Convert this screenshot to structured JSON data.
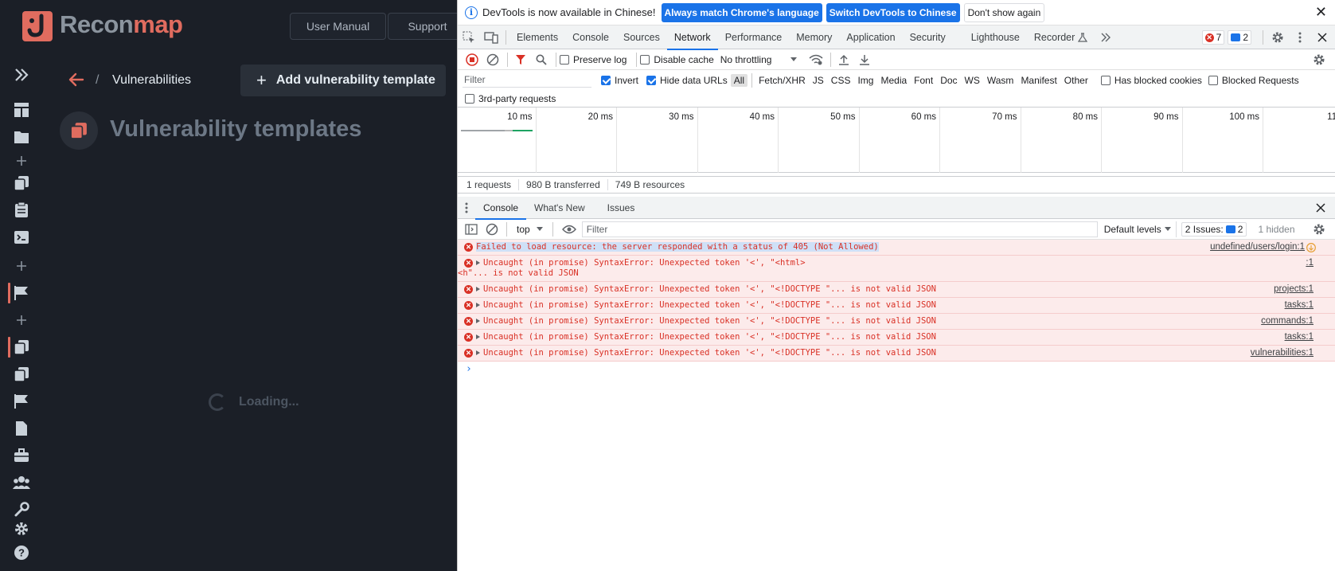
{
  "app": {
    "brand": {
      "part1": "Recon",
      "part2": "map"
    },
    "header_buttons": [
      "User Manual",
      "Support"
    ],
    "breadcrumb": {
      "separator": "/",
      "current": "Vulnerabilities"
    },
    "add_button_label": "Add vulnerability template",
    "page_title": "Vulnerability templates",
    "loading_text": "Loading...",
    "sidebar_icons": [
      "expand-icon",
      "dashboard-icon",
      "folder-icon",
      "plus-icon",
      "copy-icon",
      "clipboard-icon",
      "terminal-icon",
      "plus-icon",
      "flag-icon",
      "plus-icon",
      "copy-icon",
      "copy-icon",
      "flag-icon",
      "document-icon",
      "briefcase-icon",
      "users-icon",
      "wrench-icon",
      "gear-icon",
      "help-icon"
    ],
    "colors": {
      "bg": "#1b1f27",
      "accent": "#e06c5f"
    }
  },
  "devtools": {
    "infobar": {
      "text": "DevTools is now available in Chinese!",
      "btn_match": "Always match Chrome's language",
      "btn_switch": "Switch DevTools to Chinese",
      "btn_dismiss": "Don't show again"
    },
    "tabs": [
      "Elements",
      "Console",
      "Sources",
      "Network",
      "Performance",
      "Memory",
      "Application",
      "Security",
      "Lighthouse",
      "Recorder"
    ],
    "active_tab": "Network",
    "errors_count": "7",
    "messages_count": "2",
    "network_toolbar": {
      "preserve_log": "Preserve log",
      "disable_cache": "Disable cache",
      "throttling": "No throttling"
    },
    "filter": {
      "placeholder": "Filter",
      "invert": "Invert",
      "hide_data_urls": "Hide data URLs",
      "types": [
        "All",
        "Fetch/XHR",
        "JS",
        "CSS",
        "Img",
        "Media",
        "Font",
        "Doc",
        "WS",
        "Wasm",
        "Manifest",
        "Other"
      ],
      "has_blocked_cookies": "Has blocked cookies",
      "blocked_requests": "Blocked Requests",
      "third_party": "3rd-party requests"
    },
    "timeline_ticks": [
      "10 ms",
      "20 ms",
      "30 ms",
      "40 ms",
      "50 ms",
      "60 ms",
      "70 ms",
      "80 ms",
      "90 ms",
      "100 ms",
      "110"
    ],
    "summary": {
      "requests": "1 requests",
      "transferred": "980 B transferred",
      "resources": "749 B resources"
    },
    "drawer_tabs": [
      "Console",
      "What's New",
      "Issues"
    ],
    "console": {
      "context": "top",
      "filter_placeholder": "Filter",
      "levels": "Default levels",
      "issues_label": "2 Issues:",
      "issues_count": "2",
      "hidden": "1 hidden",
      "prompt": "›",
      "logs": [
        {
          "msg": "Failed to load resource: the server responded with a status of 405 (Not Allowed)",
          "src": "undefined/users/login:1",
          "expand": false,
          "highlight": true
        },
        {
          "msg": "Uncaught (in promise) SyntaxError: Unexpected token '<', \"<html>",
          "msg2": "<h\"... is not valid JSON",
          "src": ":1",
          "expand": true,
          "highlight": false
        },
        {
          "msg": "Uncaught (in promise) SyntaxError: Unexpected token '<', \"<!DOCTYPE \"... is not valid JSON",
          "src": "projects:1",
          "expand": true,
          "highlight": false
        },
        {
          "msg": "Uncaught (in promise) SyntaxError: Unexpected token '<', \"<!DOCTYPE \"... is not valid JSON",
          "src": "tasks:1",
          "expand": true,
          "highlight": false
        },
        {
          "msg": "Uncaught (in promise) SyntaxError: Unexpected token '<', \"<!DOCTYPE \"... is not valid JSON",
          "src": "commands:1",
          "expand": true,
          "highlight": false
        },
        {
          "msg": "Uncaught (in promise) SyntaxError: Unexpected token '<', \"<!DOCTYPE \"... is not valid JSON",
          "src": "tasks:1",
          "expand": true,
          "highlight": false
        },
        {
          "msg": "Uncaught (in promise) SyntaxError: Unexpected token '<', \"<!DOCTYPE \"... is not valid JSON",
          "src": "vulnerabilities:1",
          "expand": true,
          "highlight": false
        }
      ]
    }
  }
}
